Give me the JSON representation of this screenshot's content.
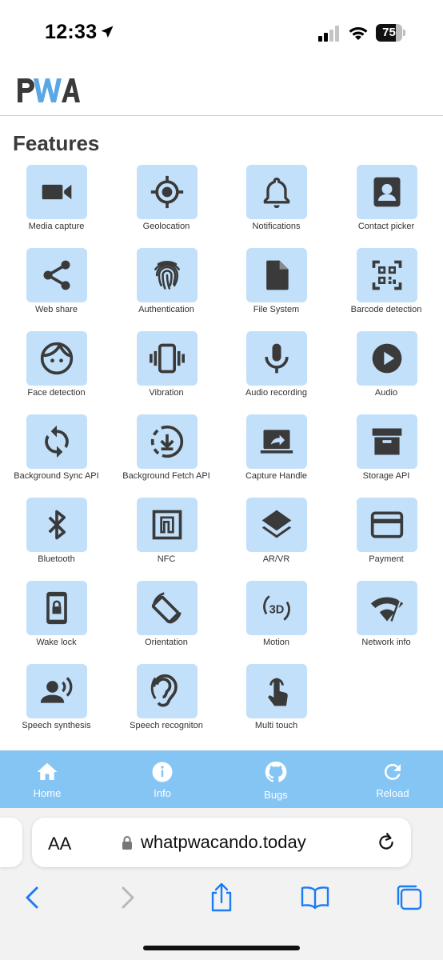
{
  "status_bar": {
    "time": "12:33",
    "battery": "75",
    "battery_level": 0.75
  },
  "header": {
    "logo_text": "PWA"
  },
  "features": {
    "title": "Features",
    "items": [
      {
        "label": "Media capture",
        "icon": "videocam-icon"
      },
      {
        "label": "Geolocation",
        "icon": "crosshair-icon"
      },
      {
        "label": "Notifications",
        "icon": "bell-icon"
      },
      {
        "label": "Contact picker",
        "icon": "contact-icon"
      },
      {
        "label": "Web share",
        "icon": "share-icon"
      },
      {
        "label": "Authentication",
        "icon": "fingerprint-icon"
      },
      {
        "label": "File System",
        "icon": "file-icon"
      },
      {
        "label": "Barcode detection",
        "icon": "qr-code-icon"
      },
      {
        "label": "Face detection",
        "icon": "face-icon"
      },
      {
        "label": "Vibration",
        "icon": "vibration-icon"
      },
      {
        "label": "Audio recording",
        "icon": "microphone-icon"
      },
      {
        "label": "Audio",
        "icon": "play-icon"
      },
      {
        "label": "Background Sync API",
        "icon": "sync-icon"
      },
      {
        "label": "Background Fetch API",
        "icon": "download-circle-icon"
      },
      {
        "label": "Capture Handle",
        "icon": "laptop-share-icon"
      },
      {
        "label": "Storage API",
        "icon": "archive-icon"
      },
      {
        "label": "Bluetooth",
        "icon": "bluetooth-icon"
      },
      {
        "label": "NFC",
        "icon": "nfc-icon"
      },
      {
        "label": "AR/VR",
        "icon": "layers-icon"
      },
      {
        "label": "Payment",
        "icon": "credit-card-icon"
      },
      {
        "label": "Wake lock",
        "icon": "phone-lock-icon"
      },
      {
        "label": "Orientation",
        "icon": "screen-rotation-icon"
      },
      {
        "label": "Motion",
        "icon": "3d-rotation-icon"
      },
      {
        "label": "Network info",
        "icon": "wifi-icon"
      },
      {
        "label": "Speech synthesis",
        "icon": "speaker-person-icon"
      },
      {
        "label": "Speech recogniton",
        "icon": "ear-icon"
      },
      {
        "label": "Multi touch",
        "icon": "touch-icon"
      }
    ]
  },
  "bottom_nav": {
    "items": [
      {
        "label": "Home",
        "icon": "home-icon"
      },
      {
        "label": "Info",
        "icon": "info-icon"
      },
      {
        "label": "Bugs",
        "icon": "github-icon"
      },
      {
        "label": "Reload",
        "icon": "reload-icon"
      }
    ]
  },
  "browser": {
    "text_size_label": "AA",
    "url": "whatpwacando.today"
  },
  "colors": {
    "tile_bg": "#c2e0fa",
    "icon": "#3a3a3a",
    "nav_bg": "#85c5f4",
    "logo_blue": "#5aa7e6"
  }
}
